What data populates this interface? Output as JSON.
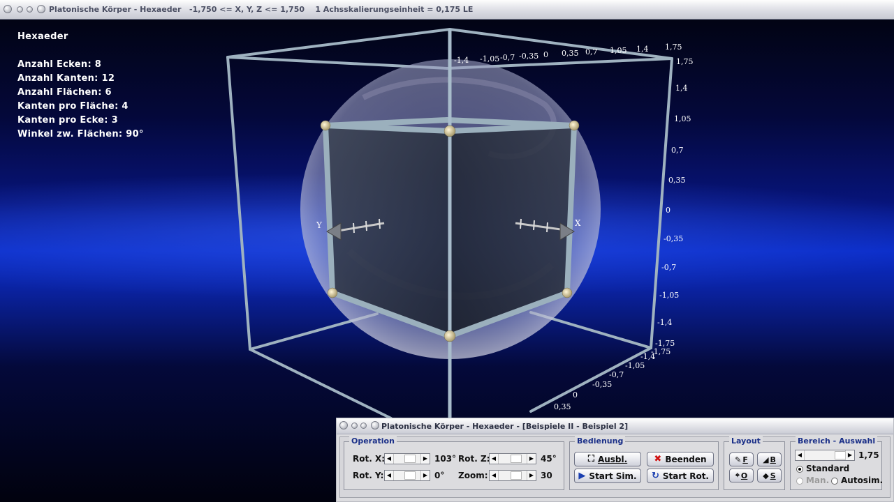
{
  "window": {
    "title": "Platonische Körper - Hexaeder   -1,750 <= X, Y, Z <= 1,750    1 Achsskalierungseinheit = 0,175 LE"
  },
  "info": {
    "heading": "Hexaeder",
    "lines": [
      "Anzahl Ecken: 8",
      "Anzahl Kanten: 12",
      "Anzahl Flächen: 6",
      "Kanten pro Fläche: 4",
      "Kanten pro Ecke: 3",
      "Winkel zw. Flächen: 90°"
    ]
  },
  "axes": {
    "x_label": "X",
    "y_label": "Y",
    "top_ticks": [
      "-1,4",
      "-1,05",
      "-0,7",
      "-0,35",
      "0",
      "0,35",
      "0,7",
      "1,05",
      "1,4",
      "1,75"
    ],
    "right_ticks": [
      "1,75",
      "1,4",
      "1,05",
      "0,7",
      "0,35",
      "0",
      "-0,35",
      "-0,7",
      "-1,05",
      "-1,4",
      "-1,75"
    ],
    "bottom_ticks": [
      "-1,75",
      "-1,4",
      "-1,05",
      "-0,7",
      "-0,35",
      "0",
      "0,35"
    ]
  },
  "panel": {
    "title": "Platonische Körper - Hexaeder - [Beispiele II - Beispiel 2]",
    "operation": {
      "label": "Operation",
      "rot_x_label": "Rot. X:",
      "rot_x_value": "103°",
      "rot_y_label": "Rot. Y:",
      "rot_y_value": "0°",
      "rot_z_label": "Rot. Z:",
      "rot_z_value": "45°",
      "zoom_label": "Zoom:",
      "zoom_value": "30"
    },
    "bedienung": {
      "label": "Bedienung",
      "ausbl": "Ausbl.",
      "beenden": "Beenden",
      "start_sim": "Start Sim.",
      "start_rot": "Start Rot."
    },
    "layout": {
      "label": "Layout",
      "f": "F",
      "b": "B",
      "o": "O",
      "s": "S"
    },
    "bereich": {
      "label": "Bereich - Auswahl",
      "value": "1,75",
      "standard": "Standard",
      "man": "Man.",
      "autosim": "Autosim."
    }
  }
}
